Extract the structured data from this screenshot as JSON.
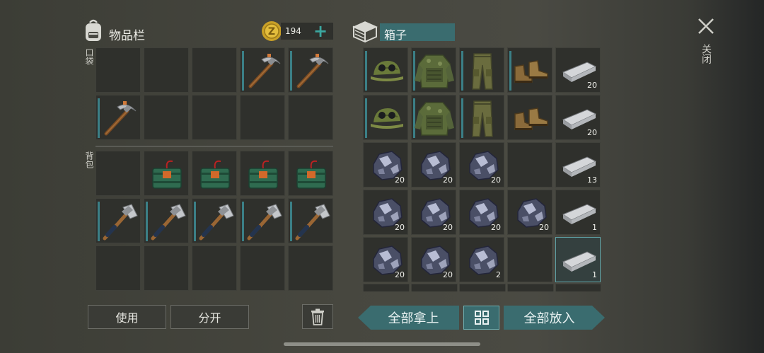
{
  "inventory": {
    "title": "物品栏",
    "coins": "194",
    "pocket_label": "口袋",
    "backpack_label": "背包",
    "pocket": [
      {
        "item": ""
      },
      {
        "item": ""
      },
      {
        "item": ""
      },
      {
        "item": "pickaxe",
        "rarity": true
      },
      {
        "item": "pickaxe",
        "rarity": true
      },
      {
        "item": "pickaxe",
        "rarity": true
      },
      {
        "item": ""
      },
      {
        "item": ""
      },
      {
        "item": ""
      },
      {
        "item": ""
      }
    ],
    "backpack": [
      {
        "item": ""
      },
      {
        "item": "bomb-crate"
      },
      {
        "item": "bomb-crate"
      },
      {
        "item": "bomb-crate"
      },
      {
        "item": "bomb-crate"
      },
      {
        "item": "axe",
        "rarity": true
      },
      {
        "item": "axe",
        "rarity": true
      },
      {
        "item": "axe",
        "rarity": true
      },
      {
        "item": "axe",
        "rarity": true
      },
      {
        "item": "axe",
        "rarity": true
      },
      {
        "item": ""
      },
      {
        "item": ""
      },
      {
        "item": ""
      },
      {
        "item": ""
      },
      {
        "item": ""
      }
    ],
    "use_label": "使用",
    "split_label": "分开"
  },
  "box": {
    "title": "箱子",
    "slots": [
      {
        "item": "cap",
        "rarity": true,
        "count": ""
      },
      {
        "item": "jacket",
        "rarity": true,
        "count": ""
      },
      {
        "item": "pants",
        "rarity": true,
        "count": ""
      },
      {
        "item": "boots",
        "rarity": true,
        "count": ""
      },
      {
        "item": "ingot",
        "count": "20"
      },
      {
        "item": "cap",
        "rarity": true,
        "count": ""
      },
      {
        "item": "jacket",
        "rarity": true,
        "count": ""
      },
      {
        "item": "pants",
        "rarity": true,
        "count": ""
      },
      {
        "item": "boots",
        "count": ""
      },
      {
        "item": "ingot",
        "count": "20"
      },
      {
        "item": "ore",
        "count": "20"
      },
      {
        "item": "ore",
        "count": "20"
      },
      {
        "item": "ore",
        "count": "20"
      },
      {
        "item": "",
        "count": ""
      },
      {
        "item": "ingot",
        "count": "13"
      },
      {
        "item": "ore",
        "count": "20"
      },
      {
        "item": "ore",
        "count": "20"
      },
      {
        "item": "ore",
        "count": "20"
      },
      {
        "item": "ore",
        "count": "20"
      },
      {
        "item": "ingot",
        "count": "1"
      },
      {
        "item": "ore",
        "count": "20"
      },
      {
        "item": "ore",
        "count": "20"
      },
      {
        "item": "ore",
        "count": "2"
      },
      {
        "item": "",
        "count": ""
      },
      {
        "item": "ingot",
        "count": "1",
        "selected": true
      }
    ],
    "take_all_label": "全部拿上",
    "put_all_label": "全部放入"
  },
  "close_label": "关闭",
  "colors": {
    "accent": "#3a6c6f",
    "rarity": "#3b7f86"
  }
}
